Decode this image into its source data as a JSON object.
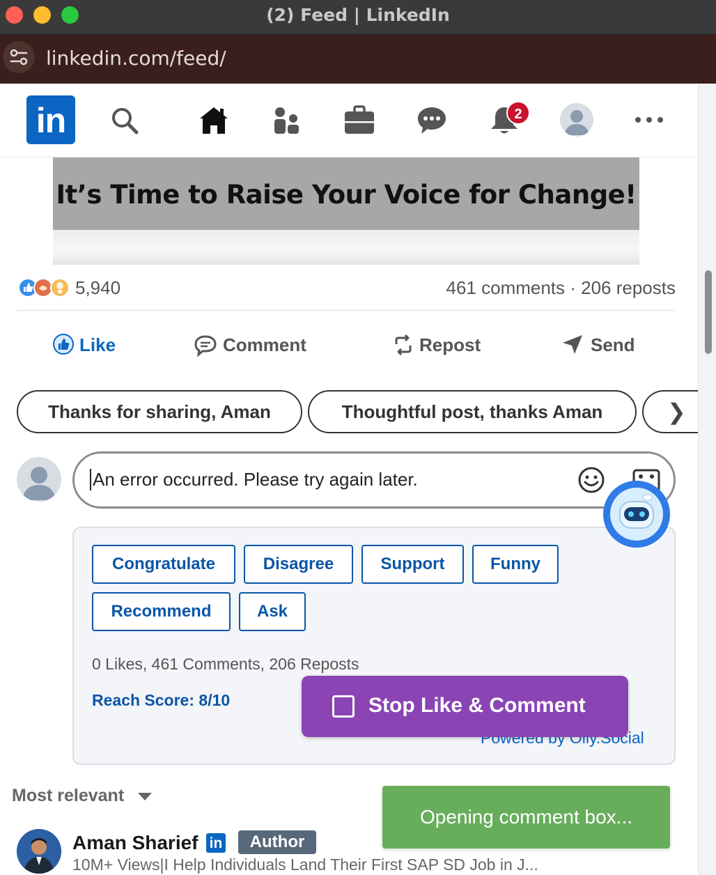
{
  "window": {
    "title": "(2) Feed | LinkedIn"
  },
  "browser": {
    "url": "linkedin.com/feed/"
  },
  "nav": {
    "logo_text": "in",
    "notification_count": "2",
    "icons": [
      "search-icon",
      "home-icon",
      "my-network-icon",
      "jobs-icon",
      "messaging-icon",
      "notifications-icon",
      "me-avatar",
      "more-icon"
    ]
  },
  "post": {
    "banner_text": "It’s Time to Raise Your Voice for Change!",
    "reaction_count": "5,940",
    "comments_reposts": "461 comments · 206 reposts",
    "actions": {
      "like": "Like",
      "comment": "Comment",
      "repost": "Repost",
      "send": "Send"
    },
    "suggestions": [
      "Thanks for sharing, Aman",
      "Thoughtful post, thanks Aman"
    ]
  },
  "comment_box": {
    "text": "An error occurred. Please try again later."
  },
  "assistant_panel": {
    "tones": [
      "Congratulate",
      "Disagree",
      "Support",
      "Funny",
      "Recommend",
      "Ask"
    ],
    "stats": "0 Likes, 461 Comments, 206 Reposts",
    "reach_score": "Reach Score: 8/10",
    "powered_by": "Powered by Olly.Social",
    "stop_button": "Stop Like & Comment"
  },
  "toast": {
    "message": "Opening comment box..."
  },
  "comments": {
    "sort_label": "Most relevant",
    "first": {
      "author": "Aman Sharief",
      "badge": "Author",
      "headline": "10M+ Views|I Help Individuals Land Their First SAP SD Job in J..."
    }
  },
  "colors": {
    "linkedin_blue": "#0a66c2",
    "stop_purple": "#8a44b3",
    "toast_green": "#67ad5b"
  }
}
